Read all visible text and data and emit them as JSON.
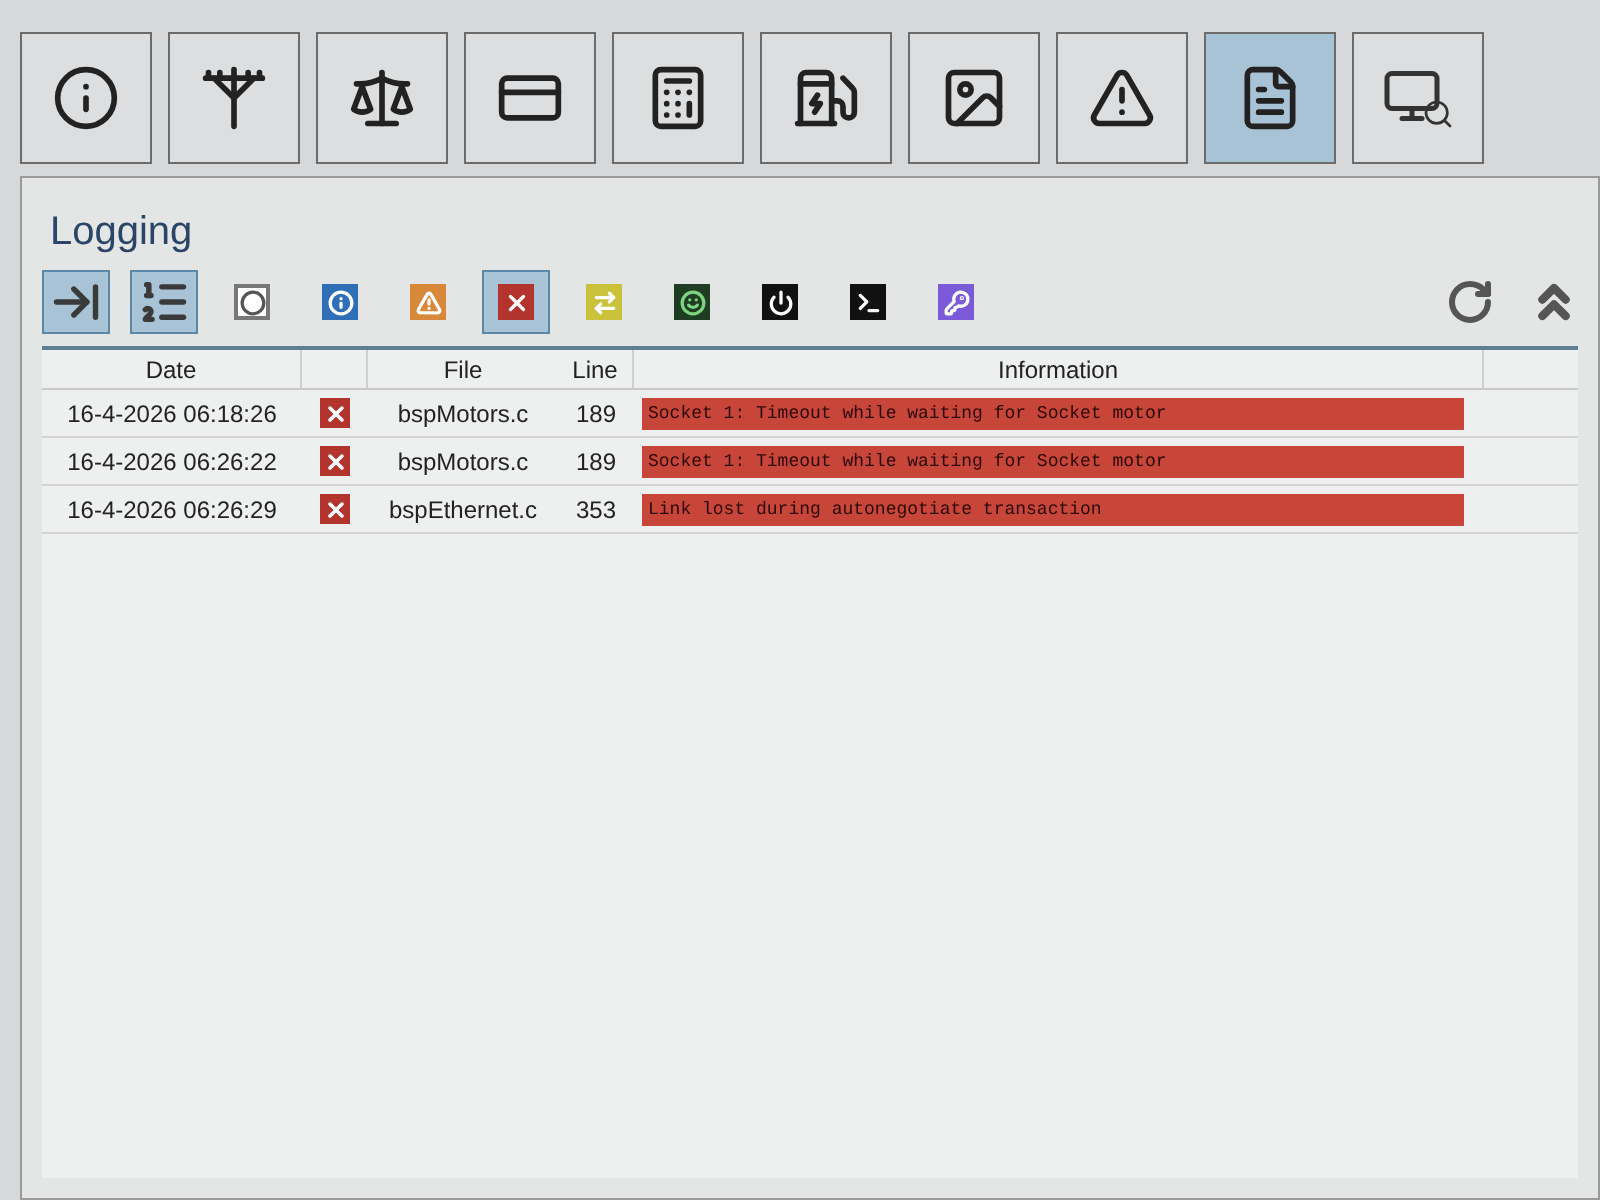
{
  "nav_tiles": [
    {
      "selected": false
    },
    {
      "selected": false
    },
    {
      "selected": false
    },
    {
      "selected": false
    },
    {
      "selected": false
    },
    {
      "selected": false
    },
    {
      "selected": false
    },
    {
      "selected": false
    },
    {
      "selected": true
    },
    {
      "selected": false
    }
  ],
  "panel": {
    "title": "Logging"
  },
  "filters": [
    {
      "selected": true
    },
    {
      "selected": true
    },
    {
      "selected": false
    },
    {
      "selected": false
    },
    {
      "selected": false
    },
    {
      "selected": true
    },
    {
      "selected": false
    },
    {
      "selected": false
    },
    {
      "selected": false
    },
    {
      "selected": false
    },
    {
      "selected": false
    }
  ],
  "table": {
    "columns": [
      "Date",
      "File",
      "Line",
      "Information"
    ],
    "rows": [
      {
        "date": "16-4-2026 06:18:26",
        "kind": "error",
        "file": "bspMotors.c",
        "line": "189",
        "information": "Socket 1: Timeout while waiting for Socket motor"
      },
      {
        "date": "16-4-2026 06:26:22",
        "kind": "error",
        "file": "bspMotors.c",
        "line": "189",
        "information": "Socket 1: Timeout while waiting for Socket motor"
      },
      {
        "date": "16-4-2026 06:26:29",
        "kind": "error",
        "file": "bspEthernet.c",
        "line": "353",
        "information": "Link lost during autonegotiate transaction"
      }
    ]
  }
}
